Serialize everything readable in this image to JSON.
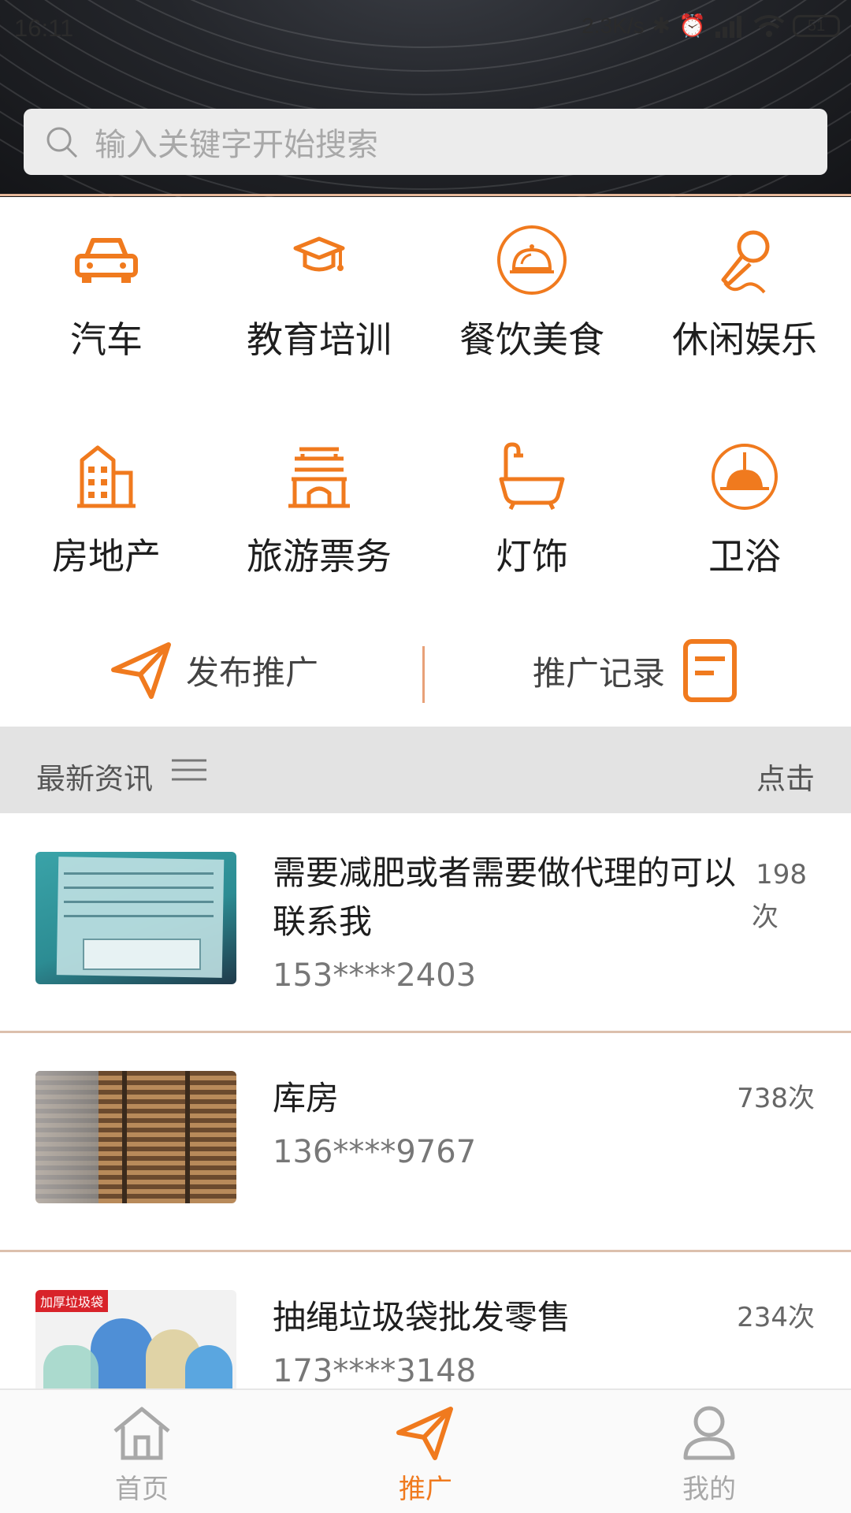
{
  "status": {
    "time": "16:11",
    "speed": "2.3K/s",
    "battery": "51"
  },
  "search": {
    "placeholder": "输入关键字开始搜索"
  },
  "categories": [
    {
      "label": "汽车",
      "icon": "car-icon"
    },
    {
      "label": "教育培训",
      "icon": "graduation-cap-icon"
    },
    {
      "label": "餐饮美食",
      "icon": "food-cloche-icon"
    },
    {
      "label": "休闲娱乐",
      "icon": "microphone-icon"
    },
    {
      "label": "房地产",
      "icon": "building-icon"
    },
    {
      "label": "旅游票务",
      "icon": "gate-tower-icon"
    },
    {
      "label": "灯饰",
      "icon": "bathtub-icon"
    },
    {
      "label": "卫浴",
      "icon": "lamp-icon"
    }
  ],
  "actions": {
    "publish": "发布推广",
    "records": "推广记录"
  },
  "news": {
    "title": "最新资讯",
    "click": "点击"
  },
  "items": [
    {
      "title_line1": "需要减肥或者需要做代理的可以",
      "title_line2": "联系我",
      "phone": "153****2403",
      "views_line1": "198",
      "views_line2": "次"
    },
    {
      "title_line1": "库房",
      "title_line2": "",
      "phone": "136****9767",
      "views_line1": "738次",
      "views_line2": ""
    },
    {
      "title_line1": "抽绳垃圾袋批发零售",
      "title_line2": "",
      "phone": "173****3148",
      "views_line1": "234次",
      "views_line2": "",
      "thumb_badge": "加厚垃圾袋"
    }
  ],
  "tabs": [
    {
      "label": "首页",
      "icon": "home-icon"
    },
    {
      "label": "推广",
      "icon": "paper-plane-icon"
    },
    {
      "label": "我的",
      "icon": "user-icon"
    }
  ],
  "colors": {
    "accent": "#f07a1e",
    "tab_inactive": "#a8a8a8"
  }
}
